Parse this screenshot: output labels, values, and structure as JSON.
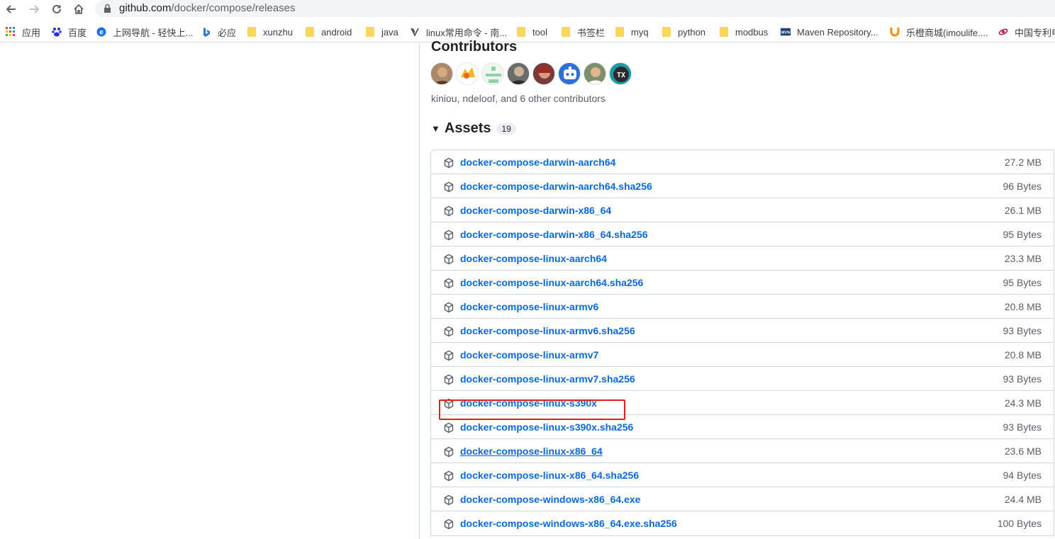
{
  "browser": {
    "url_host": "github.com",
    "url_path": "/docker/compose/releases",
    "bookmarks": [
      {
        "label": "应用",
        "icon": "apps-grid-icon"
      },
      {
        "label": "百度",
        "icon": "baidu-paw-icon"
      },
      {
        "label": "上网导航 - 轻快上...",
        "icon": "e-browser-icon"
      },
      {
        "label": "必应",
        "icon": "bing-icon"
      },
      {
        "label": "xunzhu",
        "icon": "folder-icon"
      },
      {
        "label": "android",
        "icon": "folder-icon"
      },
      {
        "label": "java",
        "icon": "folder-icon"
      },
      {
        "label": "linux常用命令 - 南...",
        "icon": "linux-icon"
      },
      {
        "label": "tool",
        "icon": "folder-icon"
      },
      {
        "label": "书签栏",
        "icon": "folder-icon"
      },
      {
        "label": "myq",
        "icon": "folder-icon"
      },
      {
        "label": "python",
        "icon": "folder-icon"
      },
      {
        "label": "modbus",
        "icon": "folder-icon"
      },
      {
        "label": "Maven Repository...",
        "icon": "mvn-icon"
      },
      {
        "label": "乐橙商城(imoulife....",
        "icon": "imou-icon"
      },
      {
        "label": "中国专利电",
        "icon": "patent-icon"
      }
    ]
  },
  "contributors": {
    "title": "Contributors",
    "summary": "kiniou, ndeloof, and 6 other contributors",
    "avatar_count": 8
  },
  "assets": {
    "title": "Assets",
    "count": "19",
    "items": [
      {
        "name": "docker-compose-darwin-aarch64",
        "size": "27.2 MB"
      },
      {
        "name": "docker-compose-darwin-aarch64.sha256",
        "size": "96 Bytes"
      },
      {
        "name": "docker-compose-darwin-x86_64",
        "size": "26.1 MB"
      },
      {
        "name": "docker-compose-darwin-x86_64.sha256",
        "size": "95 Bytes"
      },
      {
        "name": "docker-compose-linux-aarch64",
        "size": "23.3 MB"
      },
      {
        "name": "docker-compose-linux-aarch64.sha256",
        "size": "95 Bytes"
      },
      {
        "name": "docker-compose-linux-armv6",
        "size": "20.8 MB"
      },
      {
        "name": "docker-compose-linux-armv6.sha256",
        "size": "93 Bytes"
      },
      {
        "name": "docker-compose-linux-armv7",
        "size": "20.8 MB"
      },
      {
        "name": "docker-compose-linux-armv7.sha256",
        "size": "93 Bytes"
      },
      {
        "name": "docker-compose-linux-s390x",
        "size": "24.3 MB"
      },
      {
        "name": "docker-compose-linux-s390x.sha256",
        "size": "93 Bytes"
      },
      {
        "name": "docker-compose-linux-x86_64",
        "size": "23.6 MB",
        "highlighted": true
      },
      {
        "name": "docker-compose-linux-x86_64.sha256",
        "size": "94 Bytes"
      },
      {
        "name": "docker-compose-windows-x86_64.exe",
        "size": "24.4 MB"
      },
      {
        "name": "docker-compose-windows-x86_64.exe.sha256",
        "size": "100 Bytes"
      }
    ]
  },
  "colors": {
    "link": "#0969da",
    "highlight_border": "#e0211c"
  }
}
